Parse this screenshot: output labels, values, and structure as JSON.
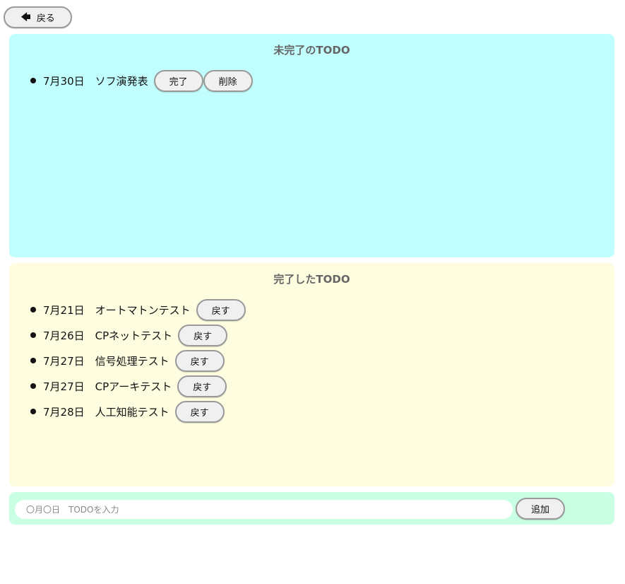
{
  "back_button": {
    "icon": "arrow-left-icon",
    "label": "戻る"
  },
  "incomplete_section": {
    "title": "未完了のTODO",
    "items": [
      {
        "text": "7月30日　ソフ演発表",
        "complete_label": "完了",
        "delete_label": "削除"
      }
    ]
  },
  "complete_section": {
    "title": "完了したTODO",
    "items": [
      {
        "text": "7月21日　オートマトンテスト",
        "back_label": "戻す"
      },
      {
        "text": "7月26日　CPネットテスト",
        "back_label": "戻す"
      },
      {
        "text": "7月27日　信号処理テスト",
        "back_label": "戻す"
      },
      {
        "text": "7月27日　CPアーキテスト",
        "back_label": "戻す"
      },
      {
        "text": "7月28日　人工知能テスト",
        "back_label": "戻す"
      }
    ]
  },
  "add_area": {
    "input_value": "",
    "input_placeholder": "〇月〇日　TODOを入力",
    "add_label": "追加"
  },
  "colors": {
    "incomplete_bg": "#c1ffff",
    "complete_bg": "#fefde0",
    "add_area_bg": "#c9ffe3",
    "title_text": "#666666",
    "button_bg": "#f0f0f0",
    "button_border": "#9a9a9a"
  }
}
